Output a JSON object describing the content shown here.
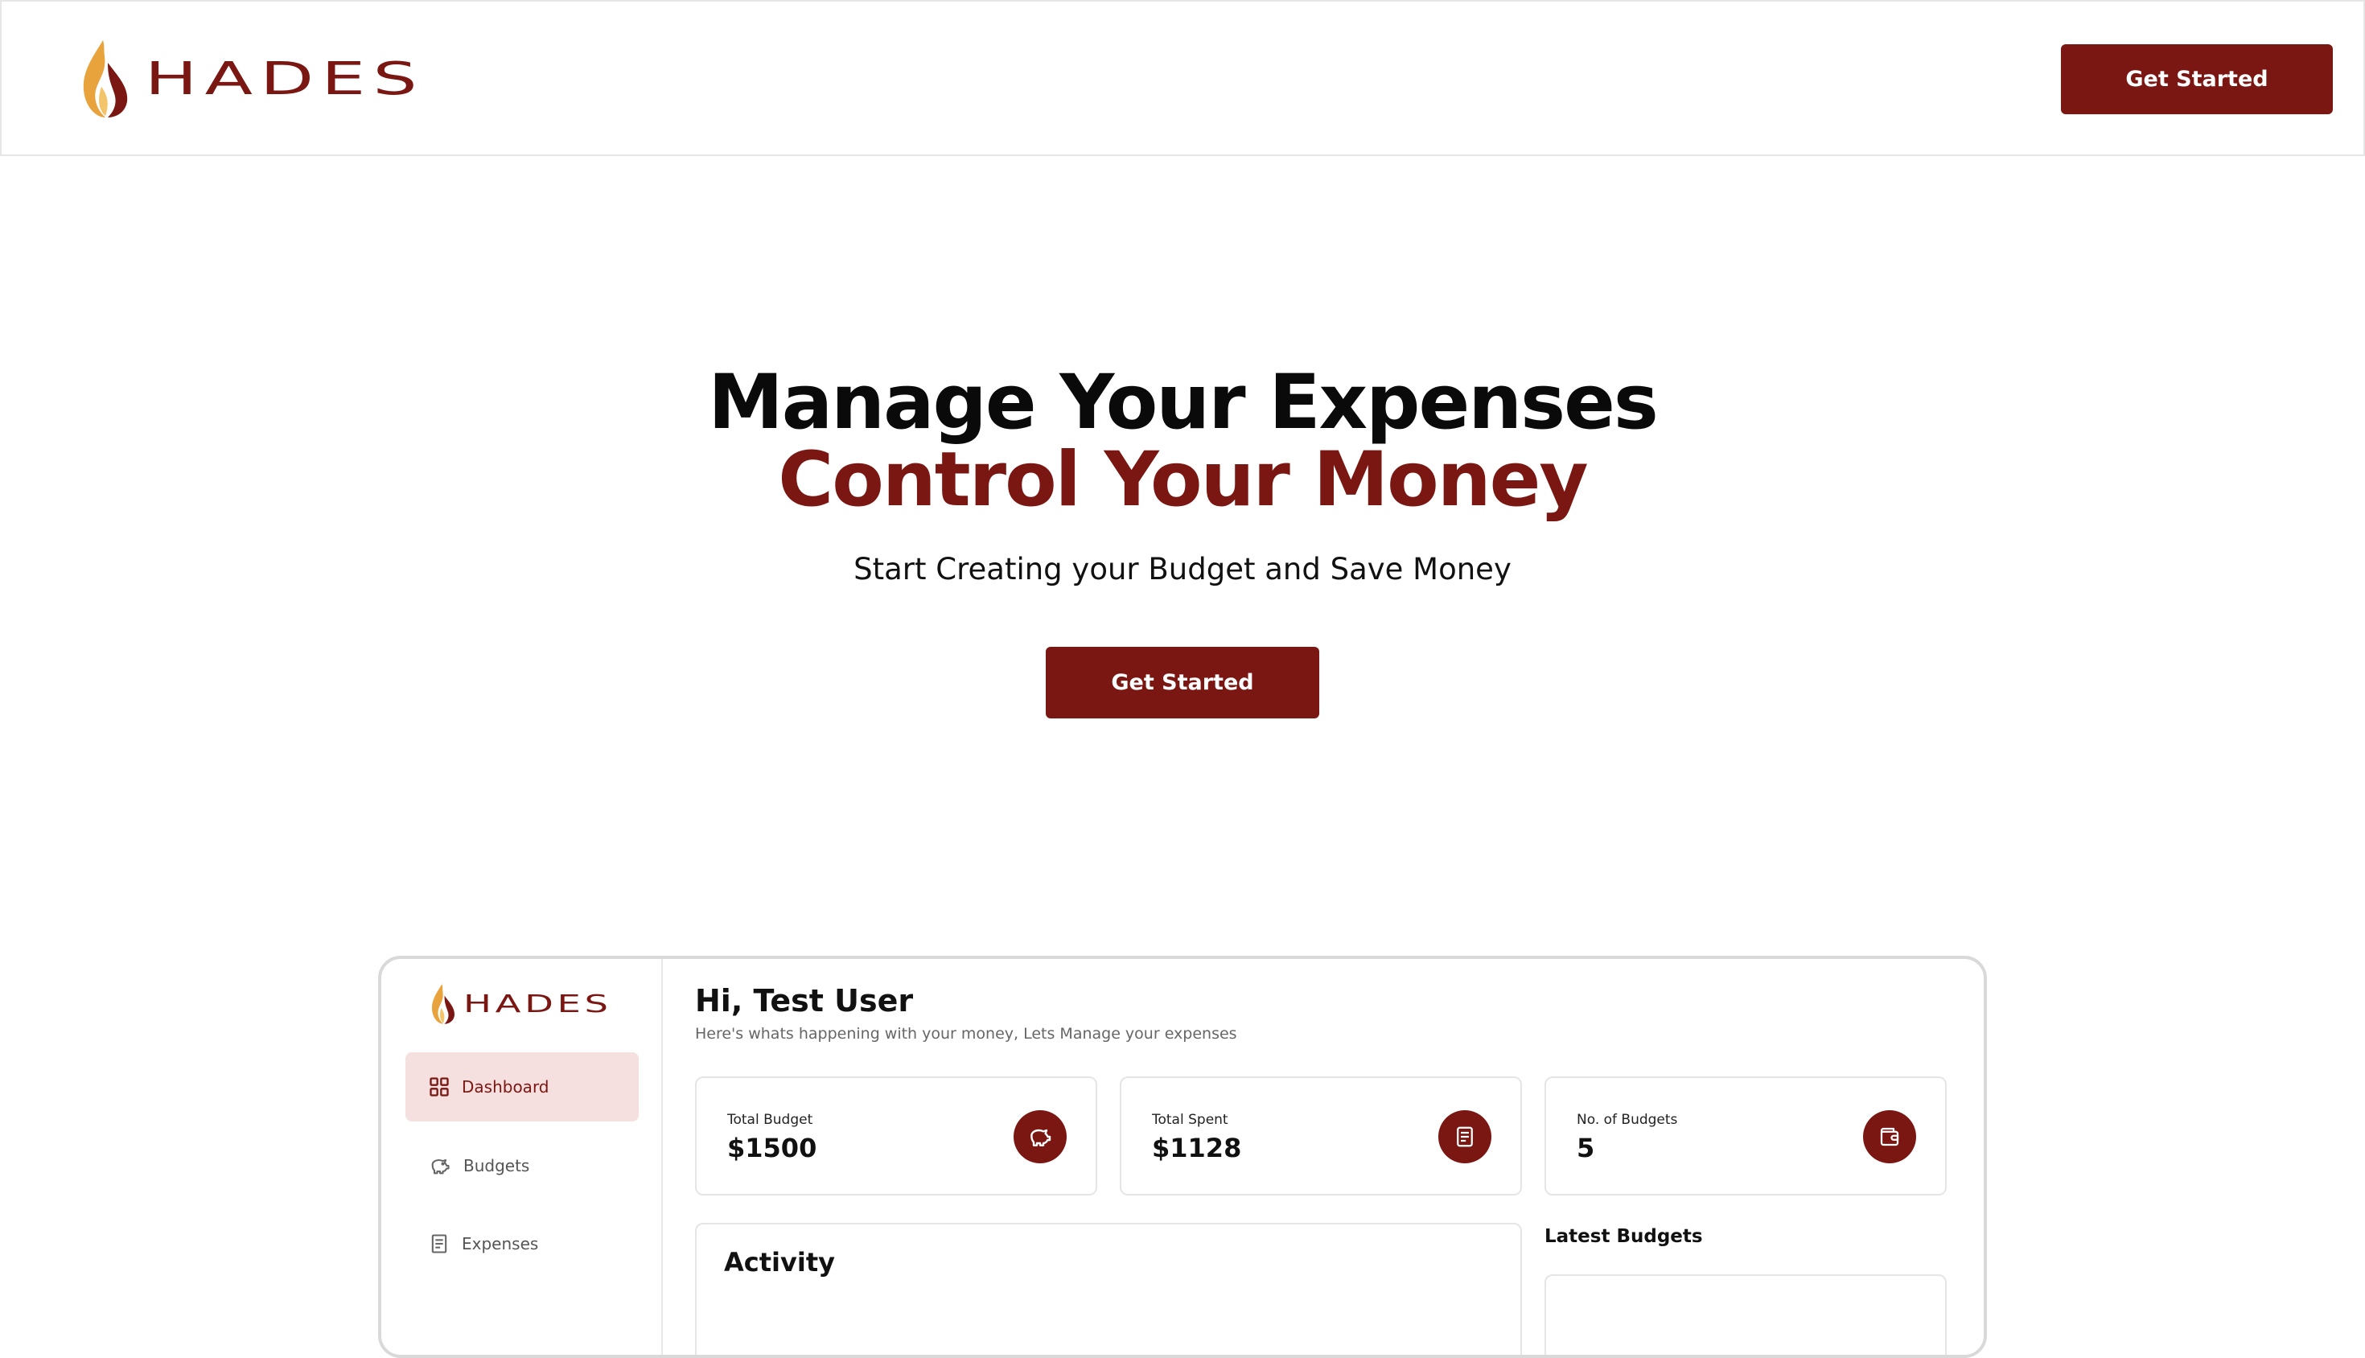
{
  "header": {
    "logo_text": "HADES",
    "cta_label": "Get Started"
  },
  "hero": {
    "line1": "Manage Your Expenses",
    "line2": "Control Your Money",
    "subtitle": "Start Creating your Budget and Save Money",
    "cta_label": "Get Started"
  },
  "preview": {
    "logo_text": "HADES",
    "sidebar": {
      "items": [
        {
          "label": "Dashboard",
          "icon": "grid-icon",
          "active": true
        },
        {
          "label": "Budgets",
          "icon": "piggy-bank-icon",
          "active": false
        },
        {
          "label": "Expenses",
          "icon": "receipt-icon",
          "active": false
        }
      ]
    },
    "greeting": "Hi, Test User",
    "greeting_sub": "Here's whats happening with your money, Lets Manage your expenses",
    "stats": [
      {
        "label": "Total Budget",
        "value": "$1500",
        "icon": "piggy-bank-icon"
      },
      {
        "label": "Total Spent",
        "value": "$1128",
        "icon": "receipt-icon"
      },
      {
        "label": "No. of Budgets",
        "value": "5",
        "icon": "wallet-icon"
      }
    ],
    "activity_title": "Activity",
    "latest_title": "Latest Budgets"
  },
  "colors": {
    "accent": "#7b1712",
    "accent_light": "#f5dfdf",
    "flame_orange": "#e8a33d"
  }
}
